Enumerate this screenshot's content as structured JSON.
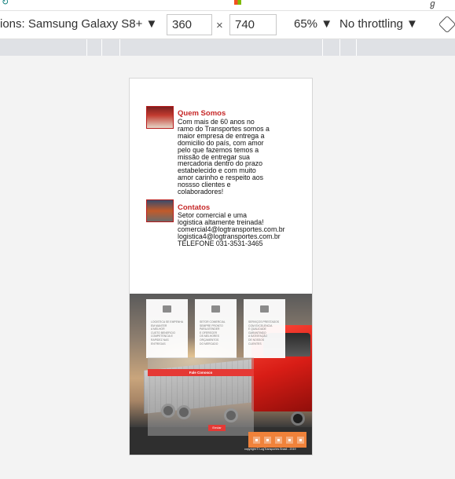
{
  "toolbar": {
    "device_label": "ions: Samsung Galaxy S8+ ▼",
    "width_value": "360",
    "times_symbol": "×",
    "height_value": "740",
    "zoom_label": "65% ▼",
    "throttle_label": "No throttling ▼"
  },
  "icons": {
    "rotate": "rotate-icon",
    "windows": "windows-logo-icon"
  },
  "page": {
    "sections": [
      {
        "title": "Quem Somos",
        "lines": [
          "Com mais de 60 anos no",
          "ramo do Transportes somos a",
          "maior empresa de entrega a",
          "domicilio do país, com amor",
          "pelo que fazemos temos a",
          "missão de entregar sua",
          "mercadoria dentro do prazo",
          "estabelecido e com muito",
          "amor carinho e respeito aos",
          "nossso clientes e",
          "colaboradores!"
        ]
      },
      {
        "title": "Contatos",
        "lines": [
          "Setor comercial e uma",
          "logistica altamente treinada!",
          "comercial4@logtransportes.com.br",
          "logistica4@logtransportes.com.br",
          "TELEFONE 031-3531-3465"
        ]
      }
    ],
    "cards": [
      {
        "text": "LOGISTICA SE EMPENHA\nEM MANTER\nA MELHOR\nCUSTO BENEFICIO\nCOMPETENCIA E\nRAPIDEZ NAS\nENTREGAS"
      },
      {
        "text": "SETOR COMERCIAL\nSEMPRE PRONTO\nPARA ATENDER\nE OFERECER\nOS MELHORES\nORÇAMENTOS\nDO MERCADO"
      },
      {
        "text": "SERVIÇOS PRESTADOS\nCOM EXCELENCIA\nE QUALIDADE\nGARANTINDO\nA SATISFAÇÃO\nDE NOSSOS\nCLIENTES"
      }
    ],
    "panel_title": "Fale Conosco",
    "send_label": "Enviar",
    "footer_text": "copyright © LogTransportes Brasil - 2019"
  },
  "colors": {
    "accent_red": "#e53935",
    "title_red": "#c62828",
    "social_orange": "#f0823a"
  }
}
